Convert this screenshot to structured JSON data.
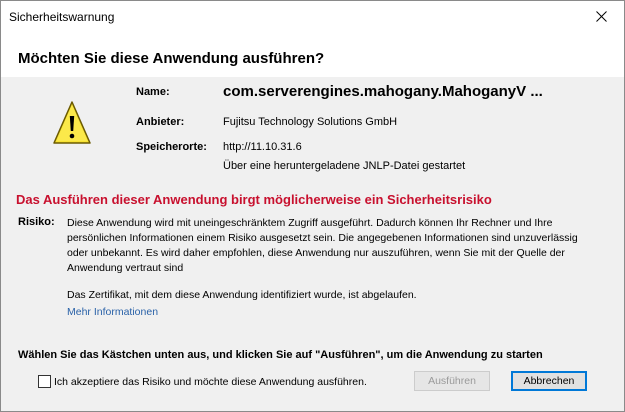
{
  "window": {
    "title": "Sicherheitswarnung"
  },
  "header": {
    "question": "Möchten Sie diese Anwendung ausführen?"
  },
  "details": {
    "name_label": "Name:",
    "name_value": "com.serverengines.mahogany.MahoganyV ...",
    "publisher_label": "Anbieter:",
    "publisher_value": "Fujitsu Technology Solutions GmbH",
    "location_label": "Speicherorte:",
    "location_value": "http://11.10.31.6",
    "location_note": "Über eine heruntergeladene JNLP-Datei gestartet"
  },
  "risk": {
    "headline": "Das Ausführen dieser Anwendung birgt möglicherweise ein Sicherheitsrisiko",
    "label": "Risiko:",
    "lines": [
      "Diese Anwendung wird mit uneingeschränktem Zugriff ausgeführt. Dadurch können Ihr Rechner und Ihre",
      "persönlichen Informationen einem Risiko ausgesetzt sein. Die angegebenen Informationen sind unzuverlässig",
      "oder unbekannt. Es wird daher empfohlen, diese Anwendung nur auszuführen, wenn Sie mit der Quelle der",
      "Anwendung vertraut sind"
    ],
    "certificate_note": "Das Zertifikat, mit dem diese Anwendung identifiziert wurde, ist abgelaufen.",
    "more_info": "Mehr Informationen"
  },
  "footer": {
    "instruction": "Wählen Sie das Kästchen unten aus, und klicken Sie auf \"Ausführen\", um die Anwendung zu starten",
    "checkbox_label": "Ich akzeptiere das Risiko und möchte diese Anwendung ausführen.",
    "run_button": "Ausführen",
    "cancel_button": "Abbrechen"
  },
  "colors": {
    "warning_red": "#c8102e",
    "link_blue": "#2a62a8",
    "focus_blue": "#0078d7"
  }
}
